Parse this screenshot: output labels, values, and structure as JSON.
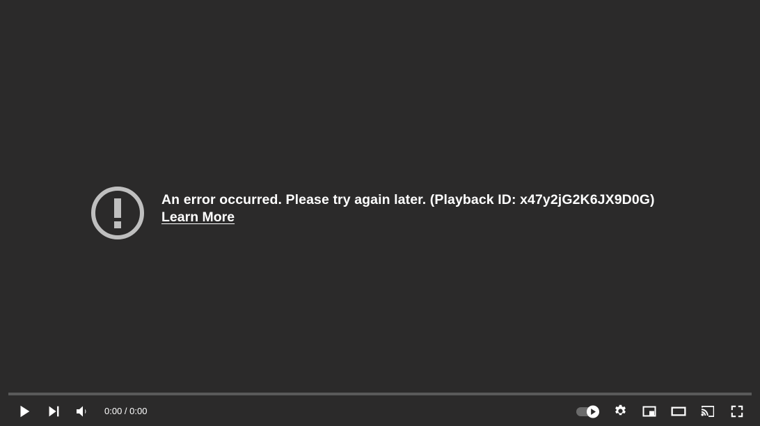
{
  "player": {
    "background_color": "#2b2a2a",
    "error": {
      "icon_name": "error-exclamation-icon",
      "icon_color": "#bfbfbf",
      "message": "An error occurred. Please try again later. (Playback ID: x47y2jG2K6JX9D0G)",
      "playback_id": "x47y2jG2K6JX9D0G",
      "link_label": "Learn More"
    },
    "controls": {
      "progress": {
        "played_percent": 0,
        "track_color": "#5a5a5a",
        "played_color": "#ff0000"
      },
      "left": {
        "play_label": "Play",
        "next_label": "Next",
        "volume_label": "Mute",
        "time_current": "0:00",
        "time_separator": "/",
        "time_total": "0:00",
        "time_display": "0:00 / 0:00"
      },
      "right": {
        "autoplay_label": "Autoplay",
        "autoplay_state": "on",
        "settings_label": "Settings",
        "miniplayer_label": "Miniplayer",
        "theater_label": "Theater mode",
        "cast_label": "Play on TV",
        "fullscreen_label": "Full screen"
      }
    }
  }
}
